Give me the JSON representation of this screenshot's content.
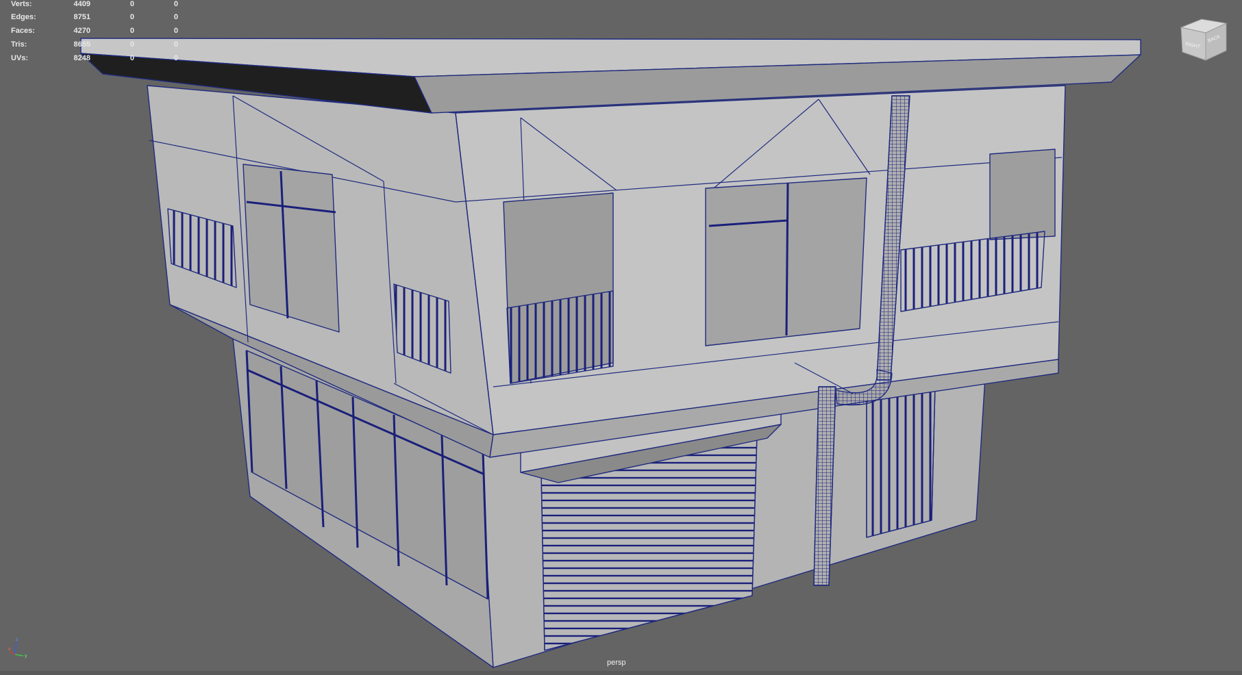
{
  "hud": {
    "rows": [
      {
        "label": "Verts:",
        "v1": "4409",
        "v2": "0",
        "v3": "0"
      },
      {
        "label": "Edges:",
        "v1": "8751",
        "v2": "0",
        "v3": "0"
      },
      {
        "label": "Faces:",
        "v1": "4270",
        "v2": "0",
        "v3": "0"
      },
      {
        "label": "Tris:",
        "v1": "8655",
        "v2": "0",
        "v3": "0"
      },
      {
        "label": "UVs:",
        "v1": "8248",
        "v2": "0",
        "v3": "0"
      }
    ]
  },
  "viewcube": {
    "right": "RIGHT",
    "back": "BACK"
  },
  "camera_label": "persp",
  "axis": {
    "z": "z",
    "x": "x",
    "y": "y"
  },
  "colors": {
    "background": "#646464",
    "wire": "#1a1f7a",
    "shade": "#b5b5b5"
  }
}
